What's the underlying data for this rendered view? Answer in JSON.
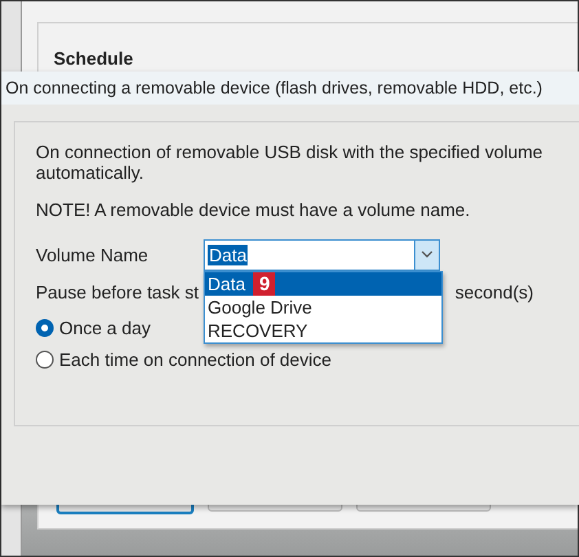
{
  "background": {
    "heading": "Schedule",
    "buttons": [
      {
        "focused": true
      },
      {
        "focused": false
      },
      {
        "focused": false
      }
    ]
  },
  "dialog": {
    "title": "On connecting a removable device (flash drives, removable HDD, etc.)",
    "description": [
      "On connection of removable USB disk with the specified volume",
      "automatically."
    ],
    "note": "NOTE! A removable device must have a volume name.",
    "volume_label": "Volume Name",
    "volume_field": {
      "value": "Data",
      "text_selected": true
    },
    "dropdown": [
      {
        "label": "Data",
        "selected": true,
        "badge": "9"
      },
      {
        "label": "Google Drive",
        "selected": false
      },
      {
        "label": "RECOVERY",
        "selected": false
      }
    ],
    "pause_label": "Pause before task st",
    "pause_unit": "second(s)",
    "schedule_options": [
      {
        "label": "Once a day",
        "selected": true
      },
      {
        "label": "Each time on connection of device",
        "selected": false
      }
    ]
  }
}
